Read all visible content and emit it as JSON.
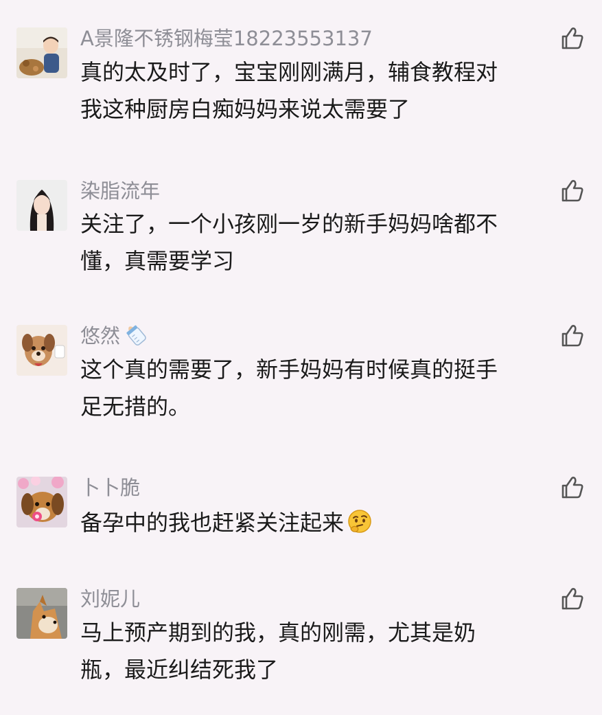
{
  "comments": [
    {
      "username": "A景隆不锈钢梅莹18223553137",
      "line1": "真的太及时了，宝宝刚刚满月，辅食教程对",
      "line2": "我这种厨房白痴妈妈来说太需要了",
      "avatar": "baby-photo"
    },
    {
      "username": "染脂流年",
      "line1": "关注了，一个小孩刚一岁的新手妈妈啥都不",
      "line2": "懂，真需要学习",
      "avatar": "girl-photo"
    },
    {
      "username": "悠然",
      "username_icon": "baby-bottle-icon",
      "line1": "这个真的需要了，新手妈妈有时候真的挺手",
      "line2": "足无措的。",
      "avatar": "cartoon-dog-photo"
    },
    {
      "username": "卜卜脆",
      "line1": "备孕中的我也赶紧关注起来",
      "line1_emoji": "thinking-face-emoji",
      "avatar": "dog-pacifier-photo"
    },
    {
      "username": "刘妮儿",
      "line1": "马上预产期到的我，真的刚需，尤其是奶",
      "line2": "瓶，最近纠结死我了",
      "avatar": "shiba-dog-photo"
    }
  ],
  "icons": {
    "like": "thumbs-up-outline-icon"
  },
  "colors": {
    "background": "#f8f3f7",
    "username": "#8e8e96",
    "text": "#1a1a1a",
    "like_icon": "#555555"
  }
}
